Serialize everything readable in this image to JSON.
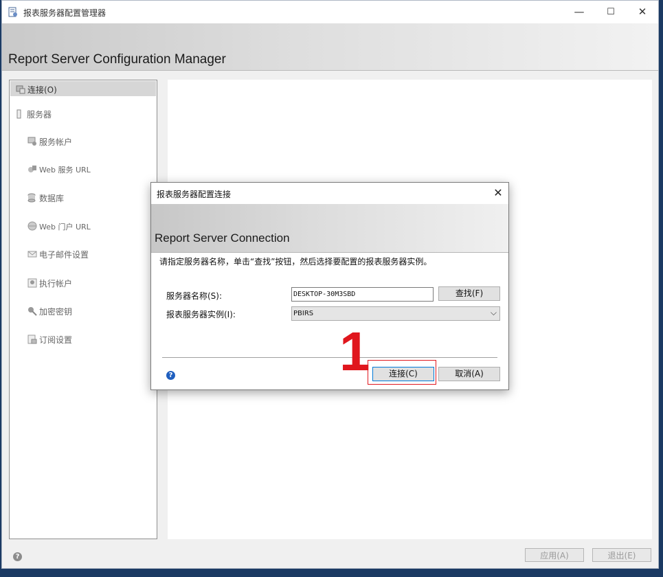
{
  "window": {
    "title": "报表服务器配置管理器",
    "minimize": "—",
    "maximize": "☐",
    "close": "✕",
    "heading": "Report Server Configuration Manager"
  },
  "nav": {
    "items": [
      {
        "label": "连接(O)",
        "icon": "connect-icon",
        "selected": true
      },
      {
        "label": "服务器",
        "icon": "server-icon"
      },
      {
        "label": "服务帐户",
        "icon": "service-account-icon"
      },
      {
        "label": "Web 服务 URL",
        "icon": "web-service-icon"
      },
      {
        "label": "数据库",
        "icon": "database-icon"
      },
      {
        "label": "Web 门户 URL",
        "icon": "globe-icon"
      },
      {
        "label": "电子邮件设置",
        "icon": "email-icon"
      },
      {
        "label": "执行帐户",
        "icon": "execution-account-icon"
      },
      {
        "label": "加密密钥",
        "icon": "key-icon"
      },
      {
        "label": "订阅设置",
        "icon": "subscription-icon"
      }
    ]
  },
  "footer": {
    "help": "?",
    "apply_label": "应用(A)",
    "exit_label": "退出(E)"
  },
  "dialog": {
    "title": "报表服务器配置连接",
    "close": "✕",
    "heading": "Report Server Connection",
    "instruction": "请指定服务器名称，单击“查找”按钮，然后选择要配置的报表服务器实例。",
    "server_name_label": "服务器名称(S):",
    "server_name_value": "DESKTOP-30M3SBD",
    "find_label": "查找(F)",
    "instance_label": "报表服务器实例(I):",
    "instance_value": "PBIRS",
    "connect_label": "连接(C)",
    "cancel_label": "取消(A)",
    "help": "?"
  },
  "annotation": {
    "number": "1",
    "color": "#e0161d"
  }
}
